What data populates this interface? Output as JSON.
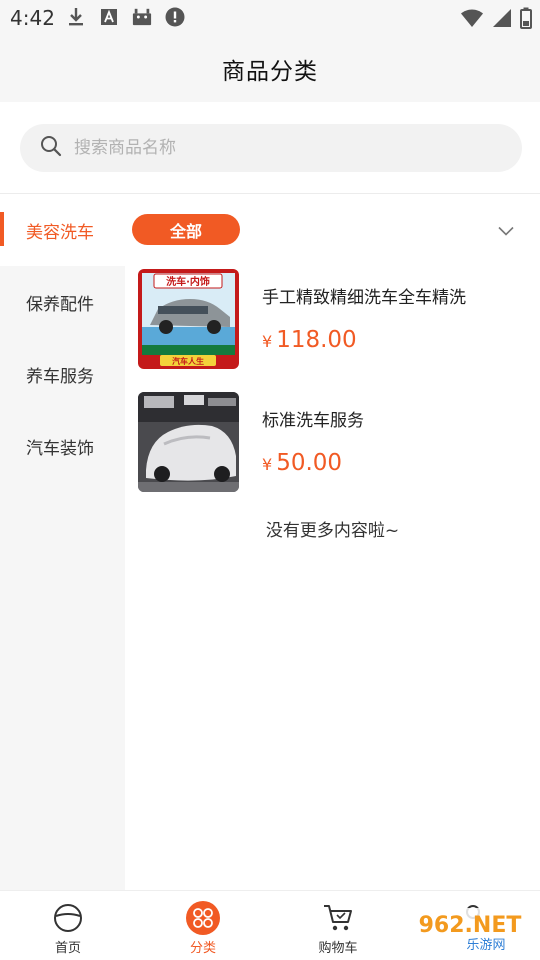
{
  "status_bar": {
    "time": "4:42",
    "icons_left": [
      "download-icon",
      "text-a-icon",
      "android-icon",
      "alert-circle-icon"
    ],
    "icons_right": [
      "wifi-icon",
      "cell-signal-icon",
      "battery-icon"
    ]
  },
  "header": {
    "title": "商品分类"
  },
  "search": {
    "placeholder": "搜索商品名称"
  },
  "categories": [
    {
      "label": "美容洗车",
      "active": true
    },
    {
      "label": "保养配件",
      "active": false
    },
    {
      "label": "养车服务",
      "active": false
    },
    {
      "label": "汽车装饰",
      "active": false
    }
  ],
  "filter": {
    "chip_label": "全部"
  },
  "products": [
    {
      "title": "手工精致精细洗车全车精洗",
      "currency": "¥",
      "price": "118.00",
      "image_text": [
        "洗车·内饰",
        "汽车人生"
      ]
    },
    {
      "title": "标准洗车服务",
      "currency": "¥",
      "price": "50.00"
    }
  ],
  "no_more": "没有更多内容啦~",
  "tabbar": [
    {
      "label": "首页",
      "icon": "steering-wheel-icon",
      "active": false
    },
    {
      "label": "分类",
      "icon": "category-grid-icon",
      "active": true
    },
    {
      "label": "购物车",
      "icon": "shopping-cart-icon",
      "active": false
    }
  ],
  "watermark": {
    "text": "962.NET",
    "subtext": "乐游网"
  },
  "colors": {
    "accent": "#f15a24",
    "background": "#f6f6f6"
  }
}
